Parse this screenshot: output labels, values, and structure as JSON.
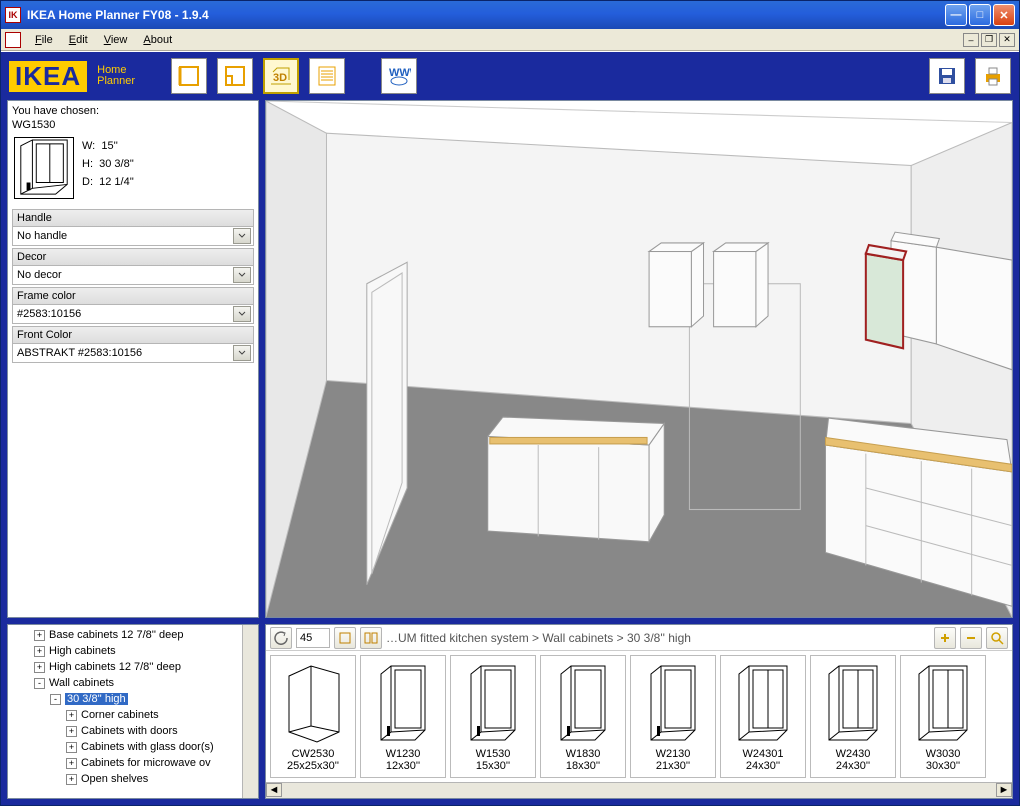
{
  "window": {
    "title": "IKEA Home Planner FY08  - 1.9.4"
  },
  "menu": {
    "file": "File",
    "edit": "Edit",
    "view": "View",
    "about": "About"
  },
  "branding": {
    "logo": "IKEA",
    "sub1": "Home",
    "sub2": "Planner"
  },
  "toolbar": {
    "www": "www"
  },
  "chosen": {
    "label": "You have chosen:",
    "model": "WG1530",
    "w_label": "W:",
    "w_val": "15''",
    "h_label": "H:",
    "h_val": "30 3/8''",
    "d_label": "D:",
    "d_val": "12 1/4''"
  },
  "config": {
    "handle": {
      "label": "Handle",
      "value": "No handle"
    },
    "decor": {
      "label": "Decor",
      "value": "No decor"
    },
    "frame": {
      "label": "Frame color",
      "value": "#2583:10156"
    },
    "front": {
      "label": "Front Color",
      "value": "ABSTRAKT #2583:10156"
    }
  },
  "tree": {
    "items": [
      {
        "indent": 1,
        "exp": "+",
        "label": "Base cabinets 12 7/8'' deep"
      },
      {
        "indent": 1,
        "exp": "+",
        "label": "High cabinets"
      },
      {
        "indent": 1,
        "exp": "+",
        "label": "High cabinets 12 7/8'' deep"
      },
      {
        "indent": 1,
        "exp": "-",
        "label": "Wall cabinets"
      },
      {
        "indent": 2,
        "exp": "-",
        "label": "30 3/8'' high",
        "selected": true
      },
      {
        "indent": 3,
        "exp": "+",
        "label": "Corner cabinets"
      },
      {
        "indent": 3,
        "exp": "+",
        "label": "Cabinets with doors"
      },
      {
        "indent": 3,
        "exp": "+",
        "label": "Cabinets with glass door(s)"
      },
      {
        "indent": 3,
        "exp": "+",
        "label": "Cabinets for microwave ov"
      },
      {
        "indent": 3,
        "exp": "+",
        "label": "Open shelves"
      }
    ]
  },
  "catalog": {
    "angle": "45",
    "crumb": "…UM fitted kitchen system > Wall cabinets > 30 3/8'' high",
    "items": [
      {
        "name": "CW2530",
        "size": "25x25x30''"
      },
      {
        "name": "W1230",
        "size": "12x30''"
      },
      {
        "name": "W1530",
        "size": "15x30''"
      },
      {
        "name": "W1830",
        "size": "18x30''"
      },
      {
        "name": "W2130",
        "size": "21x30''"
      },
      {
        "name": "W24301",
        "size": "24x30''"
      },
      {
        "name": "W2430",
        "size": "24x30''"
      },
      {
        "name": "W3030",
        "size": "30x30''"
      }
    ]
  }
}
